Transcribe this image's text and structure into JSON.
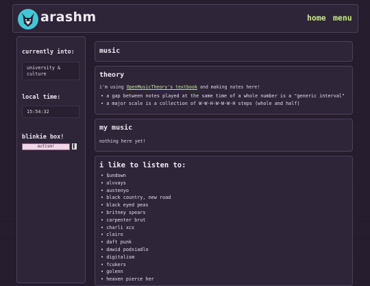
{
  "header": {
    "site_title": "arashm",
    "nav": [
      {
        "label": "home"
      },
      {
        "label": "menu"
      }
    ]
  },
  "sidebar": {
    "currently_into_heading": "currently into:",
    "currently_into_value": "university & culture",
    "local_time_heading": "local time:",
    "local_time_value": "15:54:32",
    "blinkie_heading": "blinkie box!",
    "blinkie_text": "autism!"
  },
  "main": {
    "music_heading": "music",
    "theory": {
      "heading": "theory",
      "intro_before": "i'm using ",
      "intro_link": "OpenMusicTheory's textbook",
      "intro_after": " and making notes here!",
      "notes": [
        "a gap between notes played at the same time of a whole number is a \"generic interval\"",
        "a major scale is a collection of W-W-H-W-W-W-H steps (whole and half)"
      ]
    },
    "my_music": {
      "heading": "my music",
      "text": "nothing here yet!"
    },
    "listen": {
      "heading": "i like to listen to:",
      "artists": [
        "$undown",
        "alvvays",
        "austenyo",
        "black country, new road",
        "black eyed peas",
        "britney spears",
        "carpenter brut",
        "charli xcx",
        "clairo",
        "daft punk",
        "dawid podsiadlo",
        "digitalism",
        "fcukers",
        "golenn",
        "heaven pierce her"
      ]
    }
  },
  "colors": {
    "accent_green": "#c5e98a",
    "logo_teal": "#43c7d6",
    "panel": "#2f2539",
    "border": "#4e3f5c"
  }
}
